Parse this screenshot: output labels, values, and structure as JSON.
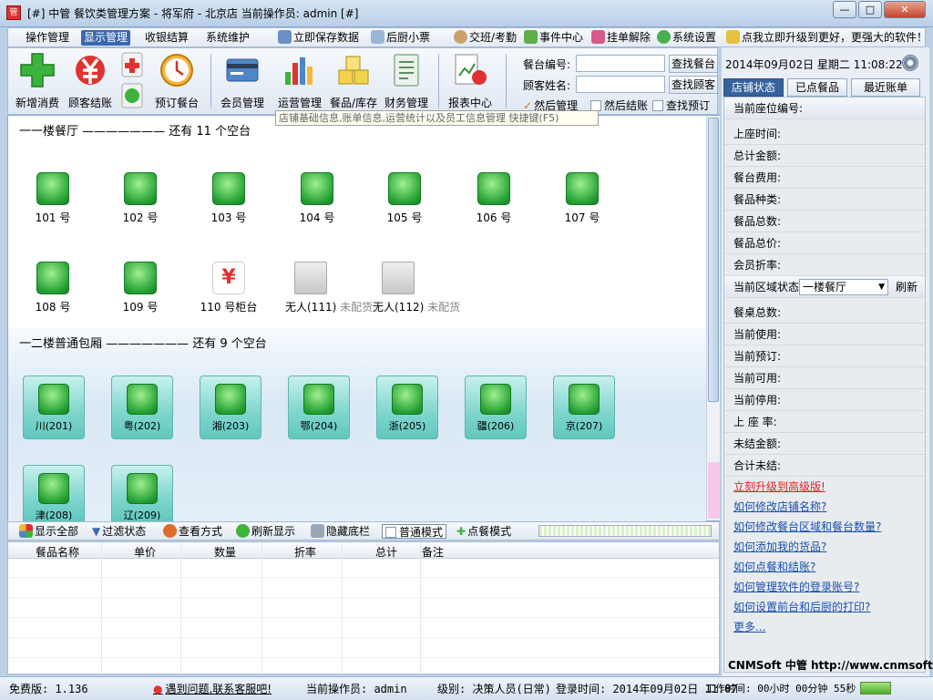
{
  "window": {
    "title": "[#] 中管 餐饮类管理方案 - 将军府 - 北京店  当前操作员: admin [#]",
    "app_icon_text": "管",
    "min": "—",
    "max": "□",
    "close": "✕"
  },
  "menu": {
    "items": [
      "操作管理",
      "显示管理",
      "收银结算",
      "系统维护"
    ],
    "tools": [
      "立即保存数据",
      "后厨小票",
      "交班/考勤",
      "事件中心",
      "挂单解除",
      "系统设置",
      "点我立即升级到更好，更强大的软件！"
    ]
  },
  "ribbon": {
    "buttons": [
      "新增消费",
      "顾客结账",
      "预订餐台",
      "会员管理",
      "运营管理",
      "餐品/库存",
      "财务管理",
      "报表中心"
    ]
  },
  "search": {
    "table_no_label": "餐台编号:",
    "find_table": "查找餐台",
    "customer_label": "顾客姓名:",
    "find_customer": "查找顾客",
    "checks": [
      "然后管理",
      "然后结账",
      "查找预订"
    ]
  },
  "tooltip": "店铺基础信息,账单信息,运营统计以及员工信息管理 快捷键(F5)",
  "floor1": {
    "header": "一一楼餐厅 ——————— 还有 11 个空台",
    "tables": [
      "101 号",
      "102 号",
      "103 号",
      "104 号",
      "105 号",
      "106 号",
      "107 号",
      "108 号",
      "109 号",
      "110 号柜台",
      "无人(111)",
      "无人(112)"
    ],
    "tag": "未配货"
  },
  "floor2": {
    "header": "一二楼普通包厢 ——————— 还有 9 个空台",
    "rooms": [
      "川(201)",
      "粤(202)",
      "湘(203)",
      "鄂(204)",
      "浙(205)",
      "疆(206)",
      "京(207)",
      "津(208)",
      "辽(209)"
    ]
  },
  "bottom_toolbar": [
    "显示全部",
    "过滤状态",
    "查看方式",
    "刷新显示",
    "隐藏底栏",
    "普通模式",
    "点餐模式"
  ],
  "order_grid": {
    "columns": [
      "餐品名称",
      "单价",
      "数量",
      "折率",
      "总计",
      "备注"
    ]
  },
  "sidebar": {
    "datetime": "2014年09月02日 星期二 11:08:22",
    "tabs": [
      "店铺状态",
      "已点餐品",
      "最近账单"
    ],
    "seat_rows": [
      "当前座位编号:",
      "上座时间:",
      "总计金额:",
      "餐台费用:",
      "餐品种类:",
      "餐品总数:",
      "餐品总价:",
      "会员折率:"
    ],
    "zone_label": "当前区域状态",
    "zone_value": "一楼餐厅",
    "refresh": "刷新",
    "zone_rows": [
      "餐桌总数:",
      "当前使用:",
      "当前预订:",
      "当前可用:",
      "当前停用:",
      "上 座 率:",
      "未结金额:",
      "合计未结:"
    ],
    "links": [
      "立刻升级到高级版!",
      "如何修改店铺名称?",
      "如何修改餐台区域和餐台数量?",
      "如何添加我的货品?",
      "如何点餐和结账?",
      "如何管理软件的登录账号?",
      "如何设置前台和后厨的打印?",
      "更多..."
    ],
    "brand": "CNMSoft 中管  http://www.cnmsoft.com"
  },
  "status": {
    "version": "免费版: 1.136",
    "help": "遇到问题,联系客服吧!",
    "operator": "当前操作员: admin",
    "level": "级别: 决策人员(日常)",
    "login": "登录时间: 2014年09月02日 11:07",
    "worktime": "工作时间: 00小时 00分钟 55秒"
  },
  "colors": {
    "accent": "#35629f",
    "table_green": "#28a336",
    "room_teal": "#7ed5cd",
    "link_blue": "#1a4fb0",
    "link_red": "#e02020"
  }
}
